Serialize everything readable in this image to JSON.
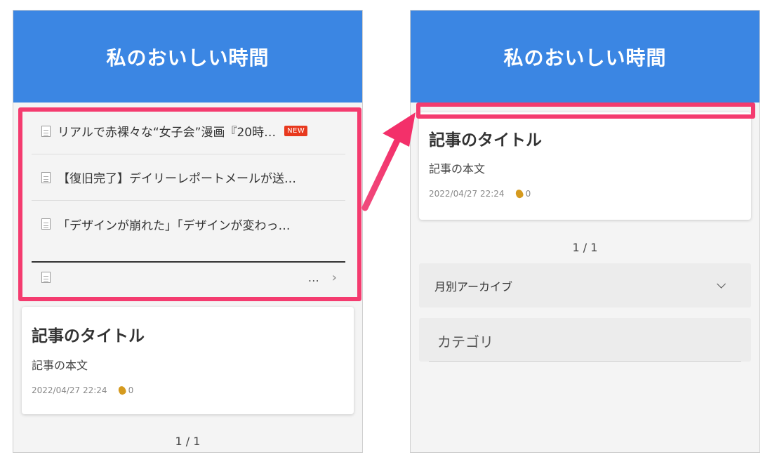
{
  "app_title": "私のおいしい時間",
  "news": {
    "items": [
      {
        "text": "リアルで赤裸々な“女子会”漫画『20時…",
        "badge": "NEW"
      },
      {
        "text": "【復旧完了】デイリーレポートメールが送…",
        "badge": ""
      },
      {
        "text": "「デザインが崩れた」「デザインが変わっ…",
        "badge": ""
      }
    ],
    "more": "…"
  },
  "article": {
    "title": "記事のタイトル",
    "body": "記事の本文",
    "date": "2022/04/27 22:24",
    "claps": "0"
  },
  "pager": "1 / 1",
  "archive_label": "月別アーカイブ",
  "category_label": "カテゴリ",
  "colors": {
    "header": "#3b86e3",
    "highlight": "#f43b6f",
    "badge": "#e8391e"
  }
}
